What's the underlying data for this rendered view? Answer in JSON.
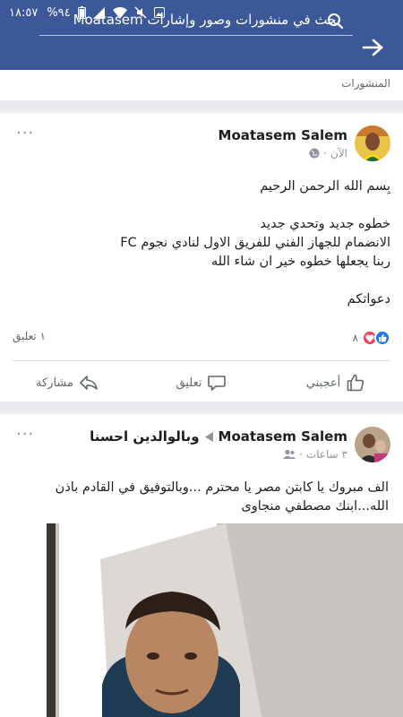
{
  "status_bar": {
    "time": "١٨:٥٧",
    "battery": "%٩٤"
  },
  "search": {
    "text": "بحث في منشورات وصور وإشارات Moatasem"
  },
  "posts_header": {
    "label": "المنشورات"
  },
  "post1": {
    "author": "Moatasem Salem",
    "time": "الآن",
    "lines": [
      "بِسم الله الرحمن الرحيم",
      "",
      "خطوه جديد وتحدي جديد",
      "الانضمام للجهاز الفني للفريق الاول  لنادي نجوم FC",
      "ربنا يجعلها خطوه خير ان شاء الله",
      "",
      "دعواتكم"
    ],
    "reaction_count": "٨",
    "comment_count": "١ تعليق",
    "actions": {
      "like": "أعجبني",
      "comment": "تعليق",
      "share": "مشاركة"
    }
  },
  "post2": {
    "author": "Moatasem Salem",
    "target": "وبالوالدين احسنا",
    "time": "٣ ساعات",
    "lines": [
      "الف مبروك يا كابتن مصر يا محترم ...وبالتوفيق في القادم باذن الله...ابنك مصطفي منجاوى"
    ]
  },
  "colors": {
    "brand": "#3b5998",
    "like_blue": "#1877f2",
    "love_red": "#f33e58"
  }
}
